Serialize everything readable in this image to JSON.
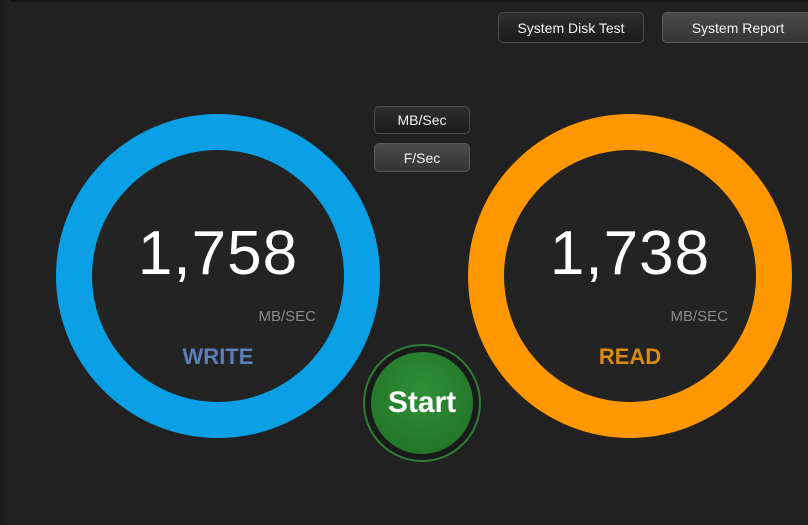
{
  "header": {
    "system_disk_test_label": "System Disk Test",
    "system_report_label": "System Report"
  },
  "units_toggle": {
    "mb_sec_label": "MB/Sec",
    "f_sec_label": "F/Sec",
    "selected": "F/Sec"
  },
  "write_gauge": {
    "value": "1,758",
    "unit": "MB/SEC",
    "label": "WRITE",
    "color": "#0ba0e6"
  },
  "read_gauge": {
    "value": "1,738",
    "unit": "MB/SEC",
    "label": "READ",
    "color": "#ff9800"
  },
  "start_button": {
    "label": "Start",
    "color": "#2f8f36"
  }
}
